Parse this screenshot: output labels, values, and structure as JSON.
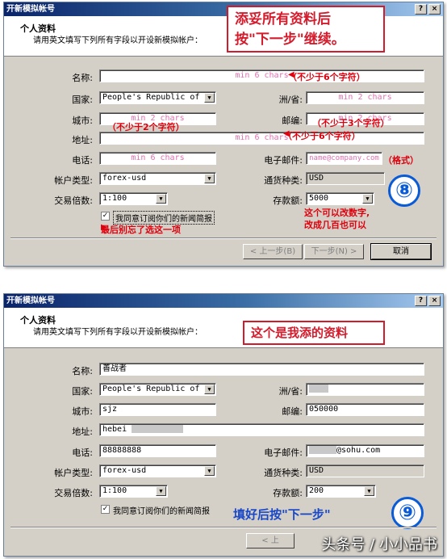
{
  "dialog1": {
    "title": "开新模拟帐号",
    "help": "?",
    "close": "×",
    "section_title": "个人资料",
    "section_sub": "请用英文填写下列所有字段以开设新模拟帐户：",
    "callout_line1": "添妥所有资料后",
    "callout_line2": "按\"下一步\"继续。",
    "labels": {
      "name": "名称:",
      "country": "国家:",
      "state": "洲/省:",
      "city": "城市:",
      "zip": "邮编:",
      "address": "地址:",
      "phone": "电话:",
      "email": "电子邮件:",
      "acct_type": "帐户类型:",
      "currency": "通货种类:",
      "leverage": "交易倍数:",
      "deposit": "存款额:"
    },
    "values": {
      "name_ph": "min 6 chars",
      "country": "People's Republic of C",
      "state_ph": "min 2 chars",
      "city_ph": "min 2 chars",
      "zip_ph": "min 2 chars",
      "address_ph": "min 6 chars",
      "phone_ph": "min 6 chars",
      "email_ph": "name@company.com",
      "acct_type": "forex-usd",
      "currency": "USD",
      "leverage": "1:100",
      "deposit": "5000"
    },
    "annotations": {
      "name": "（不少于6个字符）",
      "city": "（不少于2个字符）",
      "zip": "（不少于3个字符）",
      "address": "（不少于6个字符）",
      "email": "（格式）",
      "deposit_line1": "这个可以改数字,",
      "deposit_line2": "改成几百也可以",
      "checkbox": "最后别忘了选这一项"
    },
    "checkbox_label": "我同意订阅你们的新闻简报",
    "checkbox_mark": "✓",
    "step_number": "⑧",
    "buttons": {
      "back": "< 上一步(B)",
      "next": "下一步(N) >",
      "cancel": "取消"
    }
  },
  "dialog2": {
    "title": "开新模拟帐号",
    "help": "?",
    "close": "×",
    "section_title": "个人资料",
    "section_sub": "请用英文填写下列所有字段以开设新模拟帐户：",
    "callout": "这个是我添的资料",
    "labels": {
      "name": "名称:",
      "country": "国家:",
      "state": "洲/省:",
      "city": "城市:",
      "zip": "邮编:",
      "address": "地址:",
      "phone": "电话:",
      "email": "电子邮件:",
      "acct_type": "帐户类型:",
      "currency": "通货种类:",
      "leverage": "交易倍数:",
      "deposit": "存款额:"
    },
    "values": {
      "name": "善战者",
      "country": "People's Republic of C",
      "city": "sjz",
      "zip": "050000",
      "address": "hebei",
      "phone": "88888888",
      "email_suffix": "@sohu.com",
      "acct_type": "forex-usd",
      "currency": "USD",
      "leverage": "1:100",
      "deposit": "200"
    },
    "checkbox_label": "我同意订阅你们的新闻简报",
    "checkbox_mark": "✓",
    "annotation": "填好后按\"下一步\"",
    "step_number": "⑨",
    "buttons": {
      "back": "< 上"
    }
  },
  "watermark": "头条号 / 小小品书"
}
